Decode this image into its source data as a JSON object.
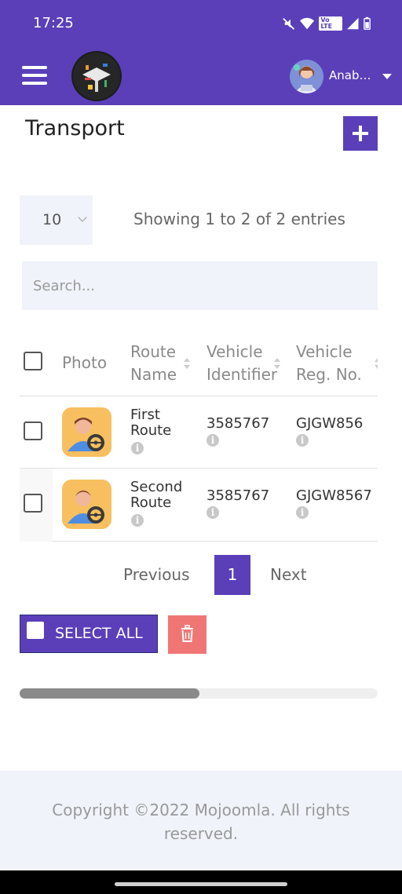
{
  "status_bar": {
    "time": "17:25",
    "network_label": "Vo LTE"
  },
  "header": {
    "user_name": "Anabelle"
  },
  "page": {
    "title": "Transport"
  },
  "table_controls": {
    "page_length": "10",
    "entries_info": "Showing 1 to 2 of 2 entries",
    "search_placeholder": "Search..."
  },
  "table": {
    "columns": [
      {
        "label_line1": "Photo",
        "label_line2": ""
      },
      {
        "label_line1": "Route",
        "label_line2": "Name"
      },
      {
        "label_line1": "Vehicle",
        "label_line2": "Identifier"
      },
      {
        "label_line1": "Vehicle",
        "label_line2": "Reg. No."
      }
    ],
    "rows": [
      {
        "route_line1": "First",
        "route_line2": "Route",
        "vehicle_identifier": "3585767",
        "vehicle_reg_no": "GJGW856"
      },
      {
        "route_line1": "Second",
        "route_line2": "Route",
        "vehicle_identifier": "3585767",
        "vehicle_reg_no": "GJGW8567"
      }
    ]
  },
  "pagination": {
    "previous": "Previous",
    "current_page": "1",
    "next": "Next"
  },
  "bulk_actions": {
    "select_all": "SELECT ALL"
  },
  "scrollbar": {
    "position_fraction": 0.5
  },
  "footer": {
    "copyright": "Copyright ©2022 Mojoomla. All rights reserved."
  },
  "colors": {
    "primary": "#5a3fb9",
    "danger": "#f07676",
    "surface": "#f0f3f9"
  },
  "icons": [
    "menu-icon",
    "school-logo",
    "user-avatar",
    "plus-icon",
    "chevron-down-icon",
    "sort-icon",
    "info-icon",
    "driver-icon",
    "trash-icon",
    "mute-icon",
    "wifi-icon",
    "signal-icon",
    "battery-icon"
  ]
}
